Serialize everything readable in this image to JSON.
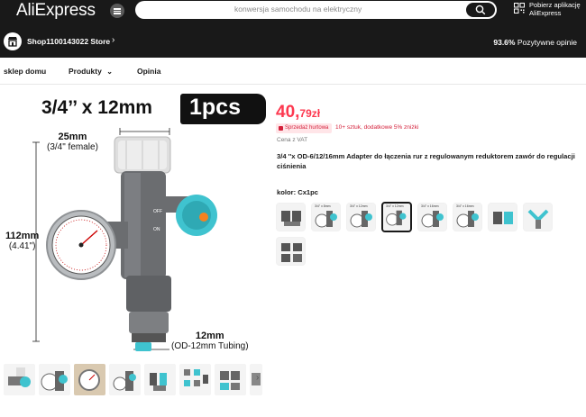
{
  "header": {
    "logo": "AliExpress",
    "search_placeholder": "konwersja samochodu na elektryczny",
    "app_promo_line1": "Pobierz aplikację",
    "app_promo_line2": "AliExpress"
  },
  "store": {
    "name": "Shop1100143022 Store",
    "rating_value": "93.6%",
    "rating_label": "Pozytywne opinie"
  },
  "nav": {
    "items": [
      "sklep domu",
      "Produkty",
      "Opinia"
    ]
  },
  "image": {
    "headline": "3/4’’ x 12mm",
    "pcs": "1pcs",
    "dim_top_value": "25mm",
    "dim_top_sub": "(3/4\" female)",
    "dim_left_value": "112mm",
    "dim_left_sub": "(4.41\")",
    "dim_bottom_value": "12mm",
    "dim_bottom_sub": "(OD-12mm Tubing)",
    "valve_label_off": "OFF",
    "valve_label_on": "ON"
  },
  "product": {
    "price_int": "40,",
    "price_dec": "79zł",
    "badge": "Sprzedaż hurtowa",
    "promo": "10+ sztuk, dodatkowe 5% zniżki",
    "vat": "Cena z VAT",
    "title": "3/4 ''x OD-6/12/16mm Adapter do łączenia rur z regulowanym reduktorem zawór do regulacji ciśnienia",
    "color_label": "kolor: Cx1pc",
    "swatches": [
      "",
      "3/4\" x 8mm",
      "3/4\" x 12mm",
      "3/4\" x 12mm",
      "3/4\" x 16mm",
      "3/4\" x 16mm",
      "",
      "",
      ""
    ]
  },
  "colors": {
    "topbar": "#191919",
    "price": "#fd384f",
    "accent_teal": "#3fc3cf",
    "valve_orange": "#f58220"
  }
}
